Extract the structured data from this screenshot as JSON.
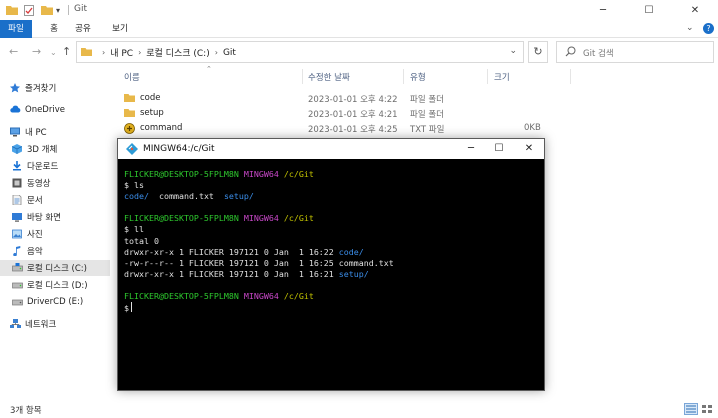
{
  "window": {
    "title": "Git"
  },
  "ribbon": {
    "tabs": [
      "파일",
      "홈",
      "공유",
      "보기"
    ]
  },
  "address": {
    "crumbs": [
      "내 PC",
      "로컬 디스크 (C:)",
      "Git"
    ],
    "search_placeholder": "Git 검색"
  },
  "sidebar": {
    "items": [
      {
        "label": "즐겨찾기",
        "icon": "star-icon"
      },
      {
        "label": "OneDrive",
        "icon": "cloud-icon"
      },
      {
        "label": "내 PC",
        "icon": "pc-icon"
      },
      {
        "label": "3D 개체",
        "icon": "cube-icon"
      },
      {
        "label": "다운로드",
        "icon": "download-icon"
      },
      {
        "label": "동영상",
        "icon": "video-icon"
      },
      {
        "label": "문서",
        "icon": "document-icon"
      },
      {
        "label": "바탕 화면",
        "icon": "desktop-icon"
      },
      {
        "label": "사진",
        "icon": "picture-icon"
      },
      {
        "label": "음악",
        "icon": "music-icon"
      },
      {
        "label": "로컬 디스크 (C:)",
        "icon": "drive-icon"
      },
      {
        "label": "로컬 디스크 (D:)",
        "icon": "drive-icon"
      },
      {
        "label": "DriverCD (E:)",
        "icon": "drive-icon"
      },
      {
        "label": "네트워크",
        "icon": "network-icon"
      }
    ]
  },
  "filelist": {
    "columns": [
      "이름",
      "수정한 날짜",
      "유형",
      "크기"
    ],
    "rows": [
      {
        "name": "code",
        "modified": "2023-01-01 오후 4:22",
        "type": "파일 폴더",
        "size": "",
        "icon": "folder-icon"
      },
      {
        "name": "setup",
        "modified": "2023-01-01 오후 4:21",
        "type": "파일 폴더",
        "size": "",
        "icon": "folder-icon"
      },
      {
        "name": "command",
        "modified": "2023-01-01 오후 4:25",
        "type": "TXT 파일",
        "size": "0KB",
        "icon": "txt-file-icon"
      }
    ]
  },
  "status": {
    "item_count": "3개 항목"
  },
  "terminal": {
    "title": "MINGW64:/c/Git",
    "prompt_user": "FLICKER@DESKTOP-5FPLM8N",
    "prompt_env": "MINGW64",
    "prompt_path": "/c/Git",
    "cmd1": "$ ls",
    "ls_dir1": "code/",
    "ls_file": "command.txt",
    "ls_dir2": "setup/",
    "cmd2": "$ ll",
    "total": "total 0",
    "ll_row1_meta": "drwxr-xr-x 1 FLICKER 197121 0 Jan  1 16:22",
    "ll_row1_name": "code/",
    "ll_row2_meta": "-rw-r--r-- 1 FLICKER 197121 0 Jan  1 16:25",
    "ll_row2_name": "command.txt",
    "ll_row3_meta": "drwxr-xr-x 1 FLICKER 197121 0 Jan  1 16:21",
    "ll_row3_name": "setup/",
    "cmd3": "$"
  },
  "colors": {
    "accent": "#1a6fc9",
    "term_green": "#2ec92e",
    "term_magenta": "#c948c9",
    "term_yellow": "#c4c400",
    "term_blue": "#3b8eea"
  }
}
